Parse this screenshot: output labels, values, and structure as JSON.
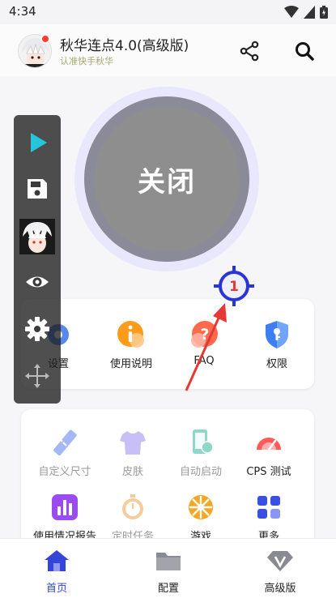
{
  "status_bar": {
    "time": "4:34"
  },
  "header": {
    "title": "秋华连点4.0(高级版)",
    "subtitle": "认准快手秋华",
    "share_icon": "share-icon",
    "search_icon": "search-icon"
  },
  "main_toggle": {
    "label": "关闭"
  },
  "target": {
    "number": "1"
  },
  "floating_toolbar": {
    "items": [
      "play-icon",
      "save-icon",
      "avatar",
      "eye-icon",
      "gear-icon",
      "move-icon"
    ]
  },
  "quick_actions": [
    {
      "label": "设置",
      "icon": "settings-icon"
    },
    {
      "label": "使用说明",
      "icon": "info-icon"
    },
    {
      "label": "FAQ",
      "icon": "help-icon"
    },
    {
      "label": "权限",
      "icon": "shield-key-icon"
    }
  ],
  "tools": [
    {
      "label": "自定义尺寸",
      "icon": "ruler-icon"
    },
    {
      "label": "皮肤",
      "icon": "shirt-icon"
    },
    {
      "label": "自动启动",
      "icon": "phone-auto-icon"
    },
    {
      "label": "CPS 测试",
      "icon": "speedometer-icon"
    },
    {
      "label": "使用情况报告",
      "icon": "bar-chart-icon"
    },
    {
      "label": "定时任务",
      "icon": "stopwatch-icon"
    },
    {
      "label": "游戏",
      "icon": "game-wheel-icon"
    },
    {
      "label": "更多",
      "icon": "grid-icon"
    }
  ],
  "bottom_nav": [
    {
      "label": "首页",
      "icon": "home-icon",
      "active": true
    },
    {
      "label": "配置",
      "icon": "folder-icon",
      "active": false
    },
    {
      "label": "高级版",
      "icon": "vip-diamond-icon",
      "active": false
    }
  ],
  "colors": {
    "accent": "#3346d9",
    "toggle_gray": "#8e8e8e",
    "ring": "#e8e7fb",
    "subtitle": "#a3a96e",
    "target_blue": "#2b34d6",
    "target_number": "#e53935",
    "arrow_red": "#e53935"
  }
}
